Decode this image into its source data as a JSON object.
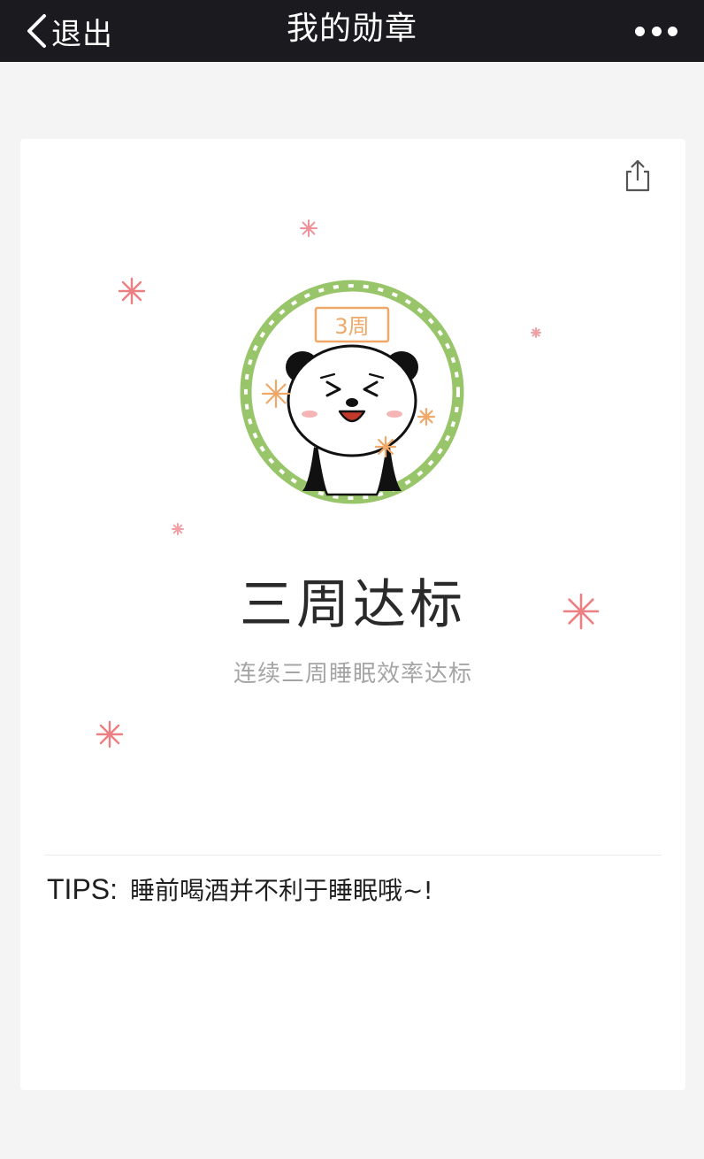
{
  "navbar": {
    "back_label": "退出",
    "title": "我的勋章",
    "back_icon": "chevron-left-icon",
    "more_icon": "more-dots-icon"
  },
  "badge": {
    "period_label": "3周",
    "title": "三周达标",
    "description": "连续三周睡眠效率达标",
    "ring_color": "#99c56a",
    "accent_color": "#f0a868"
  },
  "tips": {
    "label": "TIPS:",
    "text": "睡前喝酒并不利于睡眠哦~!"
  },
  "icons": {
    "share": "share-icon",
    "decoration": "sparkle-icon"
  }
}
